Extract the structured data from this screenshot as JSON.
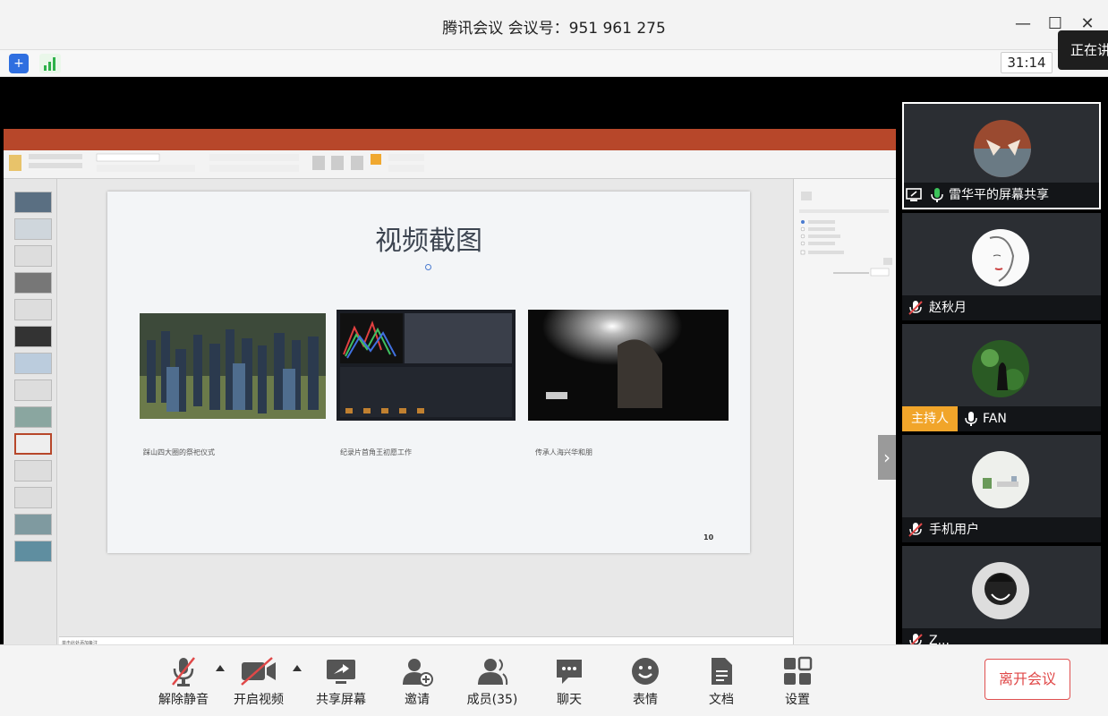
{
  "window": {
    "title": "腾讯会议 会议号：951 961 275",
    "timer": "31:14",
    "speaking_prefix": "正在讲"
  },
  "slide": {
    "title": "视频截图",
    "captions": [
      "踩山四大圈的祭祀仪式",
      "纪录片首角王初愿工作",
      "传承人海兴华和朋"
    ],
    "page_number": "10",
    "notes_placeholder": "单击此处添加备注"
  },
  "participants": [
    {
      "name": "雷华平的屏幕共享",
      "mic": "on",
      "sharing": true,
      "active": true
    },
    {
      "name": "赵秋月",
      "mic": "muted"
    },
    {
      "name": "FAN",
      "mic": "on",
      "host": true,
      "host_label": "主持人"
    },
    {
      "name": "手机用户",
      "mic": "muted"
    },
    {
      "name": "Z...",
      "mic": "muted"
    }
  ],
  "toolbar": {
    "unmute": "解除静音",
    "start_video": "开启视频",
    "share_screen": "共享屏幕",
    "invite": "邀请",
    "members": "成员(35)",
    "chat": "聊天",
    "emoji": "表情",
    "docs": "文档",
    "settings": "设置",
    "leave": "离开会议"
  },
  "colors": {
    "ppt_accent": "#b7472a",
    "host_badge": "#f1a52a",
    "leave_red": "#e04848",
    "mic_green": "#3cc35a"
  }
}
